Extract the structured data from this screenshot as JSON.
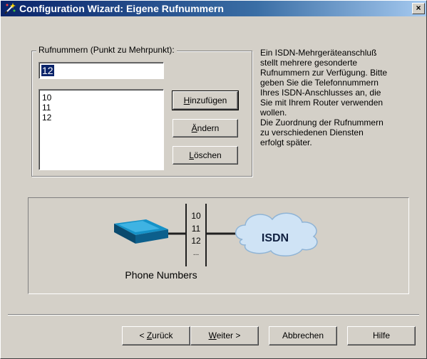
{
  "window": {
    "title": "Configuration Wizard: Eigene Rufnummern",
    "close_label": "×"
  },
  "group": {
    "label": "Rufnummern (Punkt zu Mehrpunkt):",
    "input_value": "12",
    "list_items": [
      "10",
      "11",
      "12"
    ]
  },
  "buttons": {
    "add": {
      "prefix": "",
      "accel": "H",
      "rest": "inzufügen"
    },
    "change": {
      "prefix": "",
      "accel": "Ä",
      "rest": "ndern"
    },
    "delete": {
      "prefix": "",
      "accel": "L",
      "rest": "öschen"
    },
    "back": {
      "prefix": "< ",
      "accel": "Z",
      "rest": "urück"
    },
    "next": {
      "prefix": "",
      "accel": "W",
      "rest": "eiter >"
    },
    "cancel": "Abbrechen",
    "help": "Hilfe"
  },
  "description": {
    "lines": [
      "Ein ISDN-Mehrgeräteanschluß",
      "stellt mehrere gesonderte",
      "Rufnummern zur Verfügung. Bitte",
      "geben Sie die Telefonnummern",
      "Ihres ISDN-Anschlusses an, die",
      "Sie mit Ihrem Router verwenden",
      "wollen.",
      "Die Zuordnung der Rufnummern",
      "zu verschiedenen Diensten",
      "erfolgt später."
    ]
  },
  "illustration": {
    "numbers": [
      "10",
      "11",
      "12",
      "..."
    ],
    "cloud_label": "ISDN",
    "caption": "Phone Numbers",
    "icons": [
      "router-icon",
      "isdn-cloud-icon"
    ],
    "colors": {
      "router_top": "#0f7fb0",
      "router_side": "#0a4a6e",
      "cloud": "#cfe3f5",
      "line": "#202020"
    }
  }
}
